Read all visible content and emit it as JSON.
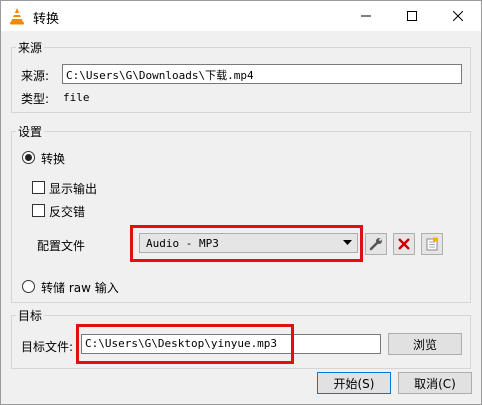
{
  "window": {
    "title": "转换"
  },
  "source": {
    "group_title": "来源",
    "source_label": "来源:",
    "source_value": "C:\\Users\\G\\Downloads\\下载.mp4",
    "type_label": "类型:",
    "type_value": "file"
  },
  "settings": {
    "group_title": "设置",
    "convert_label": "转换",
    "convert_selected": true,
    "show_output_label": "显示输出",
    "deinterlace_label": "反交错",
    "profile_label": "配置文件",
    "profile_selected": "Audio - MP3",
    "dump_raw_label": "转储 raw 输入"
  },
  "target": {
    "group_title": "目标",
    "file_label": "目标文件:",
    "file_value": "C:\\Users\\G\\Desktop\\yinyue.mp3",
    "browse_label": "浏览"
  },
  "footer": {
    "start_label": "开始(S)",
    "cancel_label": "取消(C)"
  },
  "colors": {
    "annotation": "#e01010",
    "vlc_orange": "#f08a00",
    "delete_red": "#d10000"
  }
}
